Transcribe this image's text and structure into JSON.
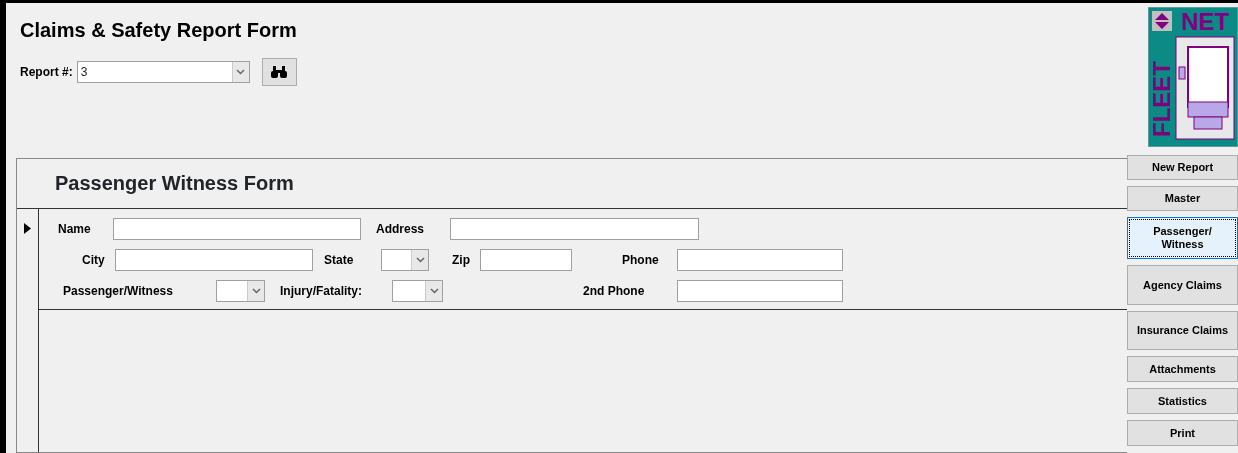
{
  "title": "Claims & Safety Report Form",
  "report": {
    "label": "Report #:",
    "value": "3"
  },
  "logo": {
    "top": "NET",
    "side": "FLEET"
  },
  "subform": {
    "title": "Passenger Witness Form",
    "rows": [
      [
        {
          "label": "Name",
          "kind": "text"
        },
        {
          "label": "Address",
          "kind": "text"
        }
      ],
      [
        {
          "label": "City",
          "kind": "text"
        },
        {
          "label": "State",
          "kind": "combo"
        },
        {
          "label": "Zip",
          "kind": "text"
        },
        {
          "label": "Phone",
          "kind": "text"
        }
      ],
      [
        {
          "label": "Passenger/Witness",
          "kind": "combo"
        },
        {
          "label": "Injury/Fatality:",
          "kind": "combo"
        },
        {
          "label": "2nd Phone",
          "kind": "text"
        }
      ]
    ]
  },
  "nav": [
    {
      "label": "New Report",
      "selected": false
    },
    {
      "label": "Master",
      "selected": false
    },
    {
      "label": "Passenger/ Witness",
      "selected": true
    },
    {
      "label": "Agency Claims",
      "selected": false
    },
    {
      "label": "Insurance Claims",
      "selected": false
    },
    {
      "label": "Attachments",
      "selected": false
    },
    {
      "label": "Statistics",
      "selected": false
    },
    {
      "label": "Print",
      "selected": false
    }
  ]
}
